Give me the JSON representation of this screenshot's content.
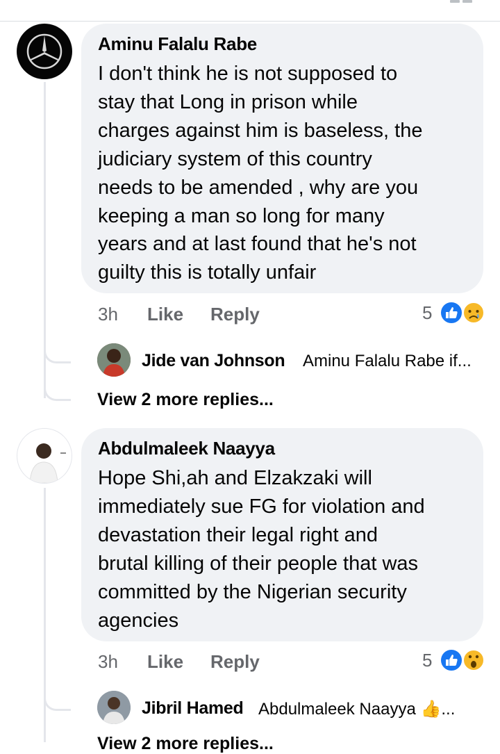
{
  "comments": [
    {
      "author": "Aminu Falalu Rabe",
      "text": "I don't think he is not supposed to\nstay that Long in prison while\ncharges against him is baseless, the\njudiciary system of this country\nneeds to be amended , why are you\nkeeping a man so long for many\nyears and at last found that he's not\nguilty this is totally unfair",
      "time": "3h",
      "like_label": "Like",
      "reply_label": "Reply",
      "reaction_count": "5",
      "reactions": [
        "like-icon",
        "sad-icon"
      ],
      "reply_preview": {
        "author": "Jide van Johnson",
        "text": "Aminu Falalu Rabe if..."
      },
      "view_more": "View 2 more replies..."
    },
    {
      "author": "Abdulmaleek Naayya",
      "text": "Hope Shi,ah and Elzakzaki will\nimmediately sue FG for violation and\ndevastation  their legal right and\nbrutal killing of their people that was\ncommitted by the Nigerian security\nagencies",
      "time": "3h",
      "like_label": "Like",
      "reply_label": "Reply",
      "reaction_count": "5",
      "reactions": [
        "like-icon",
        "wow-icon"
      ],
      "reply_preview": {
        "author": "Jibril Hamed",
        "text": "Abdulmaleek Naayya",
        "emoji": "👍",
        "ellipsis": "..."
      },
      "view_more": "View 2 more replies..."
    }
  ],
  "colors": {
    "bubble": "#f0f2f5",
    "meta": "#65676b",
    "like_blue": "#1877f2",
    "emoji_yellow": "#f7b928"
  }
}
